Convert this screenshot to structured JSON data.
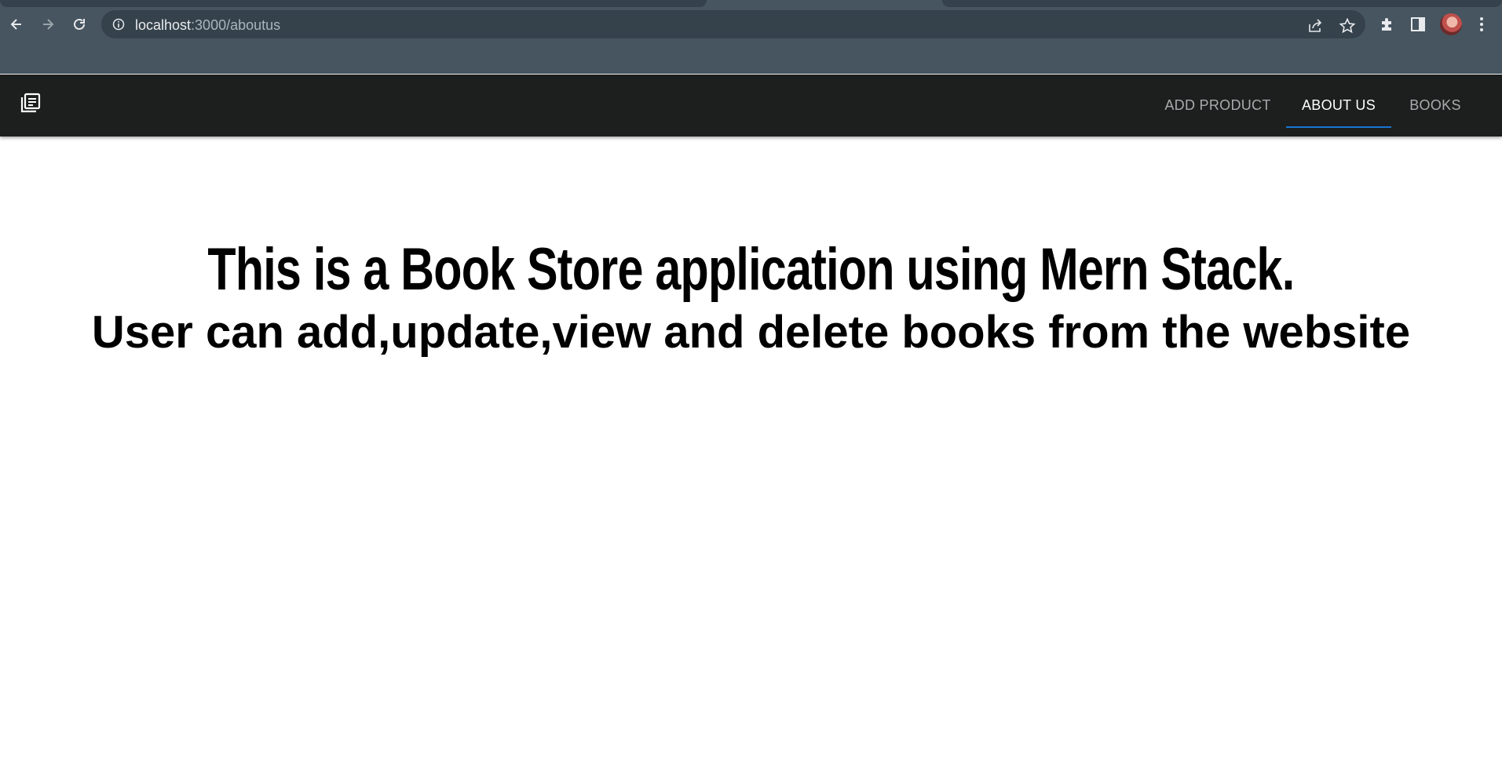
{
  "browser": {
    "url_host": "localhost",
    "url_path": ":3000/aboutus",
    "icons": {
      "back": "arrow-left-icon",
      "forward": "arrow-right-icon",
      "reload": "reload-icon",
      "site_info": "info-icon",
      "share": "share-icon",
      "bookmark": "star-icon",
      "extensions": "puzzle-icon",
      "side_panel": "side-panel-icon",
      "menu": "kebab-menu-icon",
      "profile": "avatar"
    }
  },
  "appbar": {
    "logo_icon": "library-books-icon",
    "tabs": [
      {
        "label": "ADD PRODUCT",
        "active": false
      },
      {
        "label": "ABOUT US",
        "active": true
      },
      {
        "label": "BOOKS",
        "active": false
      }
    ],
    "indicator_color": "#1976d2"
  },
  "content": {
    "heading": "This is a Book Store application using Mern Stack.",
    "subheading": "User can add,update,view and delete books from the website"
  }
}
